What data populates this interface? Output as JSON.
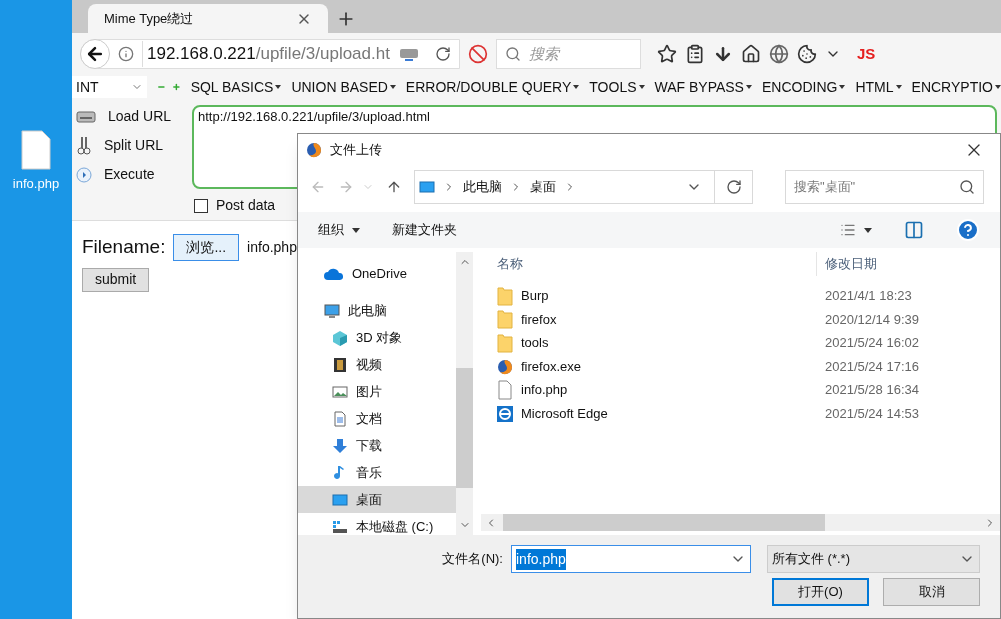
{
  "desktop": {
    "file_label": "info.php"
  },
  "browser": {
    "tabs": [
      {
        "label": "Mime Type绕过",
        "selected": true
      }
    ],
    "address": {
      "host": "192.168.0.221",
      "path": "/upfile/3/upload.ht"
    },
    "search": {
      "placeholder": "搜索"
    },
    "js_label": "JS"
  },
  "hackbar": {
    "select": "INT",
    "menus": [
      "SQL BASICS",
      "UNION BASED",
      "ERROR/DOUBLE QUERY",
      "TOOLS",
      "WAF BYPASS",
      "ENCODING",
      "HTML",
      "ENCRYPTIO"
    ],
    "actions": [
      {
        "kind": "load",
        "label": "Load URL"
      },
      {
        "kind": "split",
        "label": "Split URL"
      },
      {
        "kind": "execute",
        "label": "Execute"
      }
    ],
    "url": "http://192.168.0.221/upfile/3/upload.html",
    "post_data": {
      "label": "Post data",
      "checked": false
    }
  },
  "page": {
    "label": "Filename:",
    "browse": "浏览...",
    "file": "info.php",
    "submit": "submit"
  },
  "dialog": {
    "title": "文件上传",
    "breadcrumb": [
      "此电脑",
      "桌面"
    ],
    "search": {
      "placeholder": "搜索\"桌面\""
    },
    "toolbar": [
      {
        "label": "组织",
        "dropdown": true
      },
      {
        "label": "新建文件夹",
        "dropdown": false
      }
    ],
    "nav": [
      {
        "kind": "onedrive",
        "label": "OneDrive",
        "selected": false
      },
      {
        "kind": "pc",
        "label": "此电脑",
        "selected": false,
        "children": [
          {
            "kind": "cube",
            "label": "3D 对象",
            "selected": false
          },
          {
            "kind": "video",
            "label": "视频",
            "selected": false
          },
          {
            "kind": "image",
            "label": "图片",
            "selected": false
          },
          {
            "kind": "doc",
            "label": "文档",
            "selected": false
          },
          {
            "kind": "download",
            "label": "下载",
            "selected": false
          },
          {
            "kind": "music",
            "label": "音乐",
            "selected": false
          },
          {
            "kind": "desktop",
            "label": "桌面",
            "selected": true
          },
          {
            "kind": "drive",
            "label": "本地磁盘 (C:)",
            "selected": false
          }
        ]
      }
    ],
    "columns": [
      "名称",
      "修改日期"
    ],
    "files": [
      {
        "kind": "folder",
        "name": "Burp",
        "date": "2021/4/1 18:23"
      },
      {
        "kind": "folder",
        "name": "firefox",
        "date": "2020/12/14 9:39"
      },
      {
        "kind": "folder",
        "name": "tools",
        "date": "2021/5/24 16:02"
      },
      {
        "kind": "firefox",
        "name": "firefox.exe",
        "date": "2021/5/24 17:16"
      },
      {
        "kind": "file",
        "name": "info.php",
        "date": "2021/5/28 16:34"
      },
      {
        "kind": "edge",
        "name": "Microsoft Edge",
        "date": "2021/5/24 14:53"
      }
    ],
    "filename_label": "文件名(N):",
    "filename": "info.php",
    "filetype": "所有文件 (*.*)",
    "buttons": [
      {
        "label": "打开(O)",
        "primary": true
      },
      {
        "label": "取消",
        "primary": false
      }
    ]
  }
}
